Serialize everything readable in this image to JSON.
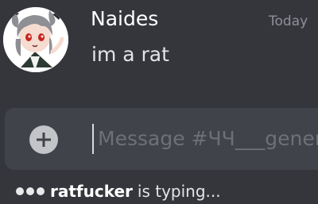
{
  "message": {
    "author": "Naides",
    "timestamp": "Today",
    "text": "im a rat"
  },
  "composer": {
    "placeholder": "Message #ЧЧ___general"
  },
  "typing": {
    "user": "ratfucker",
    "text": "is typing..."
  },
  "icons": {
    "attach": "plus-circle-icon",
    "typing": "typing-dots-icon"
  },
  "colors": {
    "background": "#34363c",
    "composer": "#40434a",
    "username": "#ffffff",
    "timestamp": "#8e9096",
    "placeholder": "#6d7077"
  }
}
